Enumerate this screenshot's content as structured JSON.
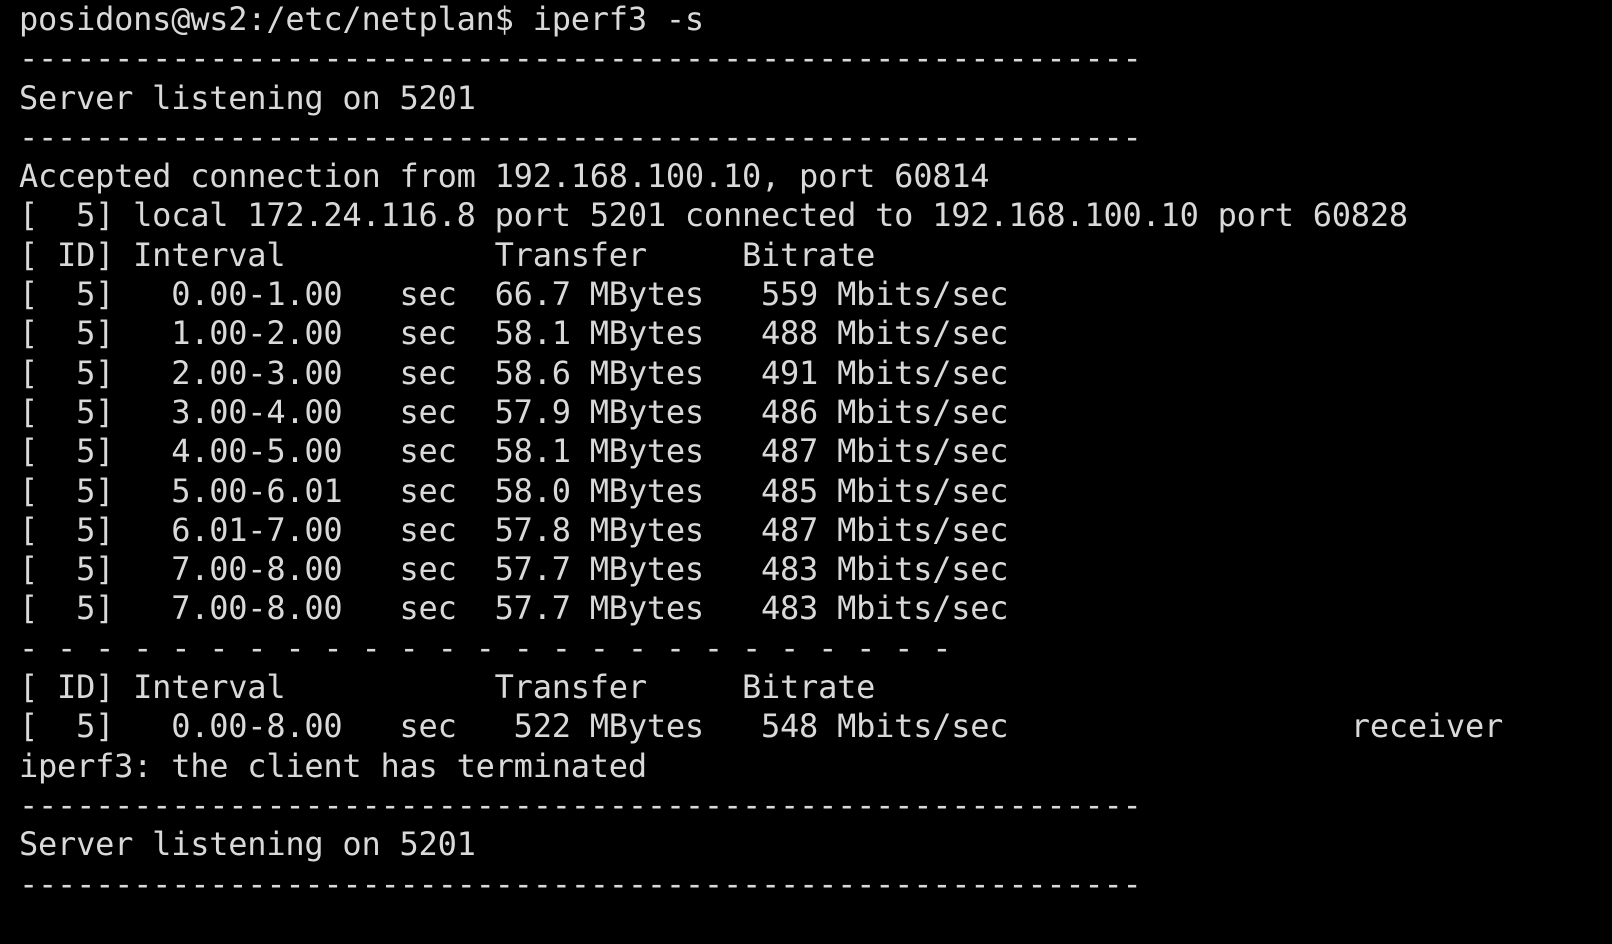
{
  "terminal": {
    "background": "#000000",
    "foreground": "#d9d9d9",
    "lines": [
      "posidons@ws2:/etc/netplan$ iperf3 -s",
      "-----------------------------------------------------------",
      "Server listening on 5201",
      "-----------------------------------------------------------",
      "Accepted connection from 192.168.100.10, port 60814",
      "[  5] local 172.24.116.8 port 5201 connected to 192.168.100.10 port 60828",
      "[ ID] Interval           Transfer     Bitrate",
      "[  5]   0.00-1.00   sec  66.7 MBytes   559 Mbits/sec",
      "[  5]   1.00-2.00   sec  58.1 MBytes   488 Mbits/sec",
      "[  5]   2.00-3.00   sec  58.6 MBytes   491 Mbits/sec",
      "[  5]   3.00-4.00   sec  57.9 MBytes   486 Mbits/sec",
      "[  5]   4.00-5.00   sec  58.1 MBytes   487 Mbits/sec",
      "[  5]   5.00-6.01   sec  58.0 MBytes   485 Mbits/sec",
      "[  5]   6.01-7.00   sec  57.8 MBytes   487 Mbits/sec",
      "[  5]   7.00-8.00   sec  57.7 MBytes   483 Mbits/sec",
      "[  5]   7.00-8.00   sec  57.7 MBytes   483 Mbits/sec",
      "- - - - - - - - - - - - - - - - - - - - - - - - -",
      "[ ID] Interval           Transfer     Bitrate",
      "[  5]   0.00-8.00   sec   522 MBytes   548 Mbits/sec                  receiver",
      "iperf3: the client has terminated",
      "-----------------------------------------------------------",
      "Server listening on 5201",
      "-----------------------------------------------------------"
    ]
  }
}
